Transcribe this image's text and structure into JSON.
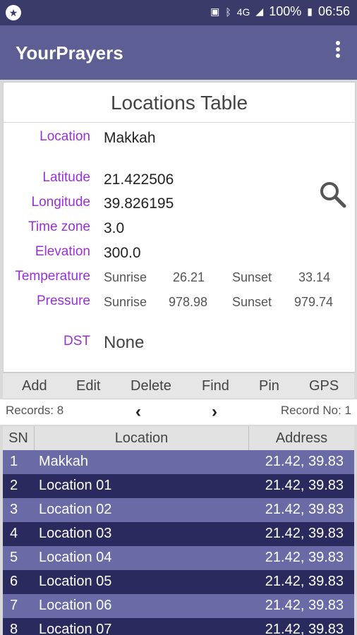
{
  "status": {
    "network": "4G",
    "battery": "100%",
    "time": "06:56"
  },
  "appbar": {
    "title": "YourPrayers"
  },
  "card": {
    "title": "Locations Table",
    "location_label": "Location",
    "location_value": "Makkah",
    "latitude_label": "Latitude",
    "latitude_value": "21.422506",
    "longitude_label": "Longitude",
    "longitude_value": "39.826195",
    "timezone_label": "Time zone",
    "timezone_value": "3.0",
    "elevation_label": "Elevation",
    "elevation_value": "300.0",
    "temperature_label": "Temperature",
    "temp_sunrise_label": "Sunrise",
    "temp_sunrise_value": "26.21",
    "temp_sunset_label": "Sunset",
    "temp_sunset_value": "33.14",
    "pressure_label": "Pressure",
    "pres_sunrise_label": "Sunrise",
    "pres_sunrise_value": "978.98",
    "pres_sunset_label": "Sunset",
    "pres_sunset_value": "979.74",
    "dst_label": "DST",
    "dst_value": "None"
  },
  "actions": [
    "Add",
    "Edit",
    "Delete",
    "Find",
    "Pin",
    "GPS"
  ],
  "nav": {
    "records": "Records: 8",
    "record_no": "Record No: 1",
    "prev": "‹",
    "next": "›"
  },
  "table": {
    "headers": [
      "SN",
      "Location",
      "Address"
    ],
    "rows": [
      {
        "sn": "1",
        "location": "Makkah",
        "address": "21.42, 39.83"
      },
      {
        "sn": "2",
        "location": "Location 01",
        "address": "21.42, 39.83"
      },
      {
        "sn": "3",
        "location": "Location 02",
        "address": "21.42, 39.83"
      },
      {
        "sn": "4",
        "location": "Location 03",
        "address": "21.42, 39.83"
      },
      {
        "sn": "5",
        "location": "Location 04",
        "address": "21.42, 39.83"
      },
      {
        "sn": "6",
        "location": "Location 05",
        "address": "21.42, 39.83"
      },
      {
        "sn": "7",
        "location": "Location 06",
        "address": "21.42, 39.83"
      },
      {
        "sn": "8",
        "location": "Location 07",
        "address": "21.42, 39.83"
      }
    ]
  },
  "colors": {
    "appbar": "#5d5e94",
    "status": "#3b3b6b",
    "label": "#9b30d9",
    "row_light": "#6a6aa6",
    "row_dark": "#2a2a5e"
  }
}
